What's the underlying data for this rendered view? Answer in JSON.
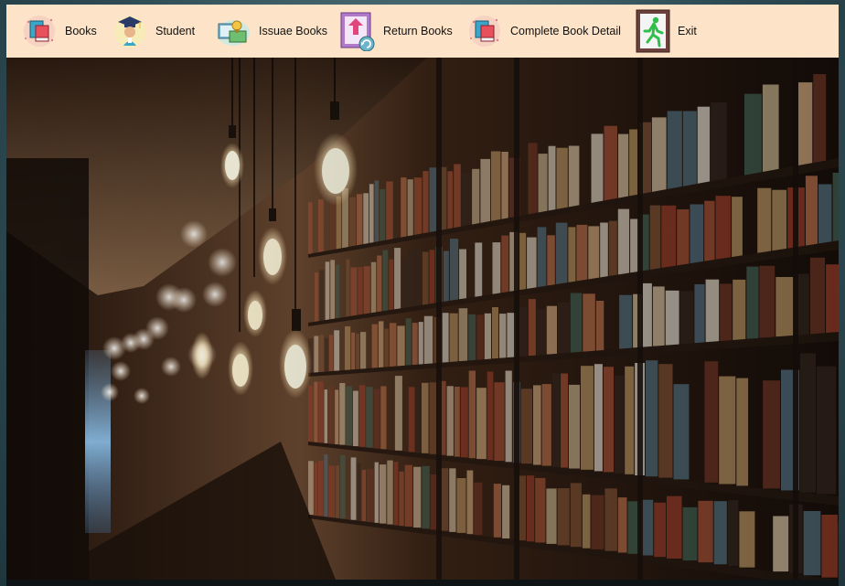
{
  "toolbar": {
    "items": [
      {
        "label": "Books",
        "icon": "books-icon"
      },
      {
        "label": "Student",
        "icon": "student-icon"
      },
      {
        "label": "Issuae Books",
        "icon": "issue-books-icon"
      },
      {
        "label": "Return Books",
        "icon": "return-books-icon"
      },
      {
        "label": "Complete Book Detail",
        "icon": "book-detail-icon"
      },
      {
        "label": "Exit",
        "icon": "exit-icon"
      }
    ]
  },
  "background": {
    "description_icon": "library-bookshelf-image"
  },
  "colors": {
    "toolbar_bg": "#fde3c7",
    "exit_icon_bg": "#6b3f3a",
    "exit_figure": "#2fbf4a"
  }
}
